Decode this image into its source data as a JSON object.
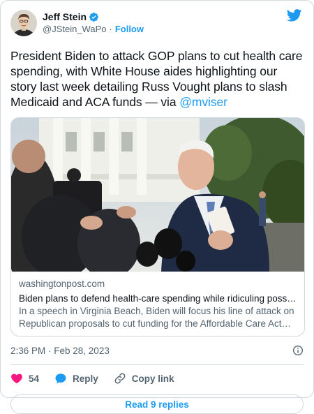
{
  "author": {
    "name": "Jeff Stein",
    "handle": "@JStein_WaPo",
    "separator": "·",
    "follow_label": "Follow"
  },
  "tweet": {
    "text_before_mention": "President Biden to attack GOP plans to cut health care spending, with White House aides highlighting our story last week detailing Russ Vought plans to slash Medicaid and ACA funds — via ",
    "mention": "@mviser"
  },
  "link_card": {
    "domain": "washingtonpost.com",
    "title": "Biden plans to defend health-care spending while ridiculing possible GOP cuts",
    "description": "In a speech in Virginia Beach, Biden will focus his line of attack on Republican proposals to cut funding for the Affordable Care Act and Medicaid."
  },
  "meta": {
    "timestamp": "2:36 PM · Feb 28, 2023"
  },
  "actions": {
    "like_count": "54",
    "reply_label": "Reply",
    "copy_link_label": "Copy link"
  },
  "footer": {
    "read_replies_label": "Read 9 replies"
  },
  "colors": {
    "accent": "#1d9bf0",
    "like": "#f91880",
    "text_secondary": "#536471"
  }
}
